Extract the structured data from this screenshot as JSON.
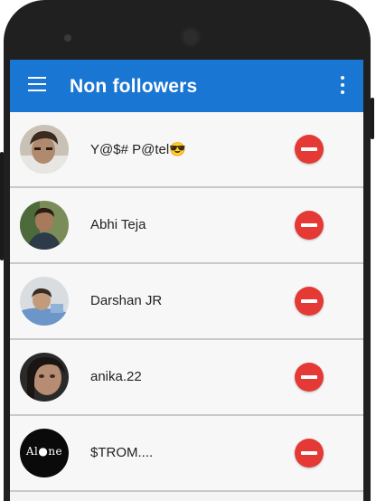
{
  "app_bar": {
    "title": "Non followers",
    "background_color": "#1976d2",
    "menu_icon": "hamburger-menu-icon",
    "overflow_icon": "more-vert-icon"
  },
  "remove_button": {
    "icon": "remove-circle-icon",
    "color": "#e53935"
  },
  "users": [
    {
      "name": "Y@$# P@tel😎"
    },
    {
      "name": "Abhi Teja"
    },
    {
      "name": "Darshan JR"
    },
    {
      "name": "anika.22"
    },
    {
      "name": "$TROM...."
    }
  ],
  "avatar_logo_text": "Al●ne"
}
